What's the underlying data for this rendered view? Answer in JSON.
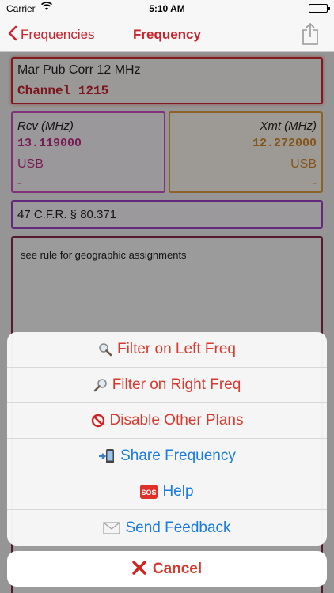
{
  "status_bar": {
    "carrier": "Carrier",
    "time": "5:10 AM"
  },
  "nav": {
    "back_label": "Frequencies",
    "title": "Frequency"
  },
  "detail": {
    "name": "Mar Pub Corr 12 MHz",
    "channel": "Channel 1215",
    "rcv": {
      "label": "Rcv (MHz)",
      "freq": "13.119000",
      "mode": "USB",
      "extra": "-"
    },
    "xmt": {
      "label": "Xmt (MHz)",
      "freq": "12.272000",
      "mode": "USB",
      "extra": "-"
    },
    "rule": "47 C.F.R. § 80.371",
    "notes": "see rule for geographic assignments"
  },
  "action_sheet": {
    "items": [
      {
        "icon": "magnifier-left-icon",
        "label": "Filter on Left Freq",
        "color": "#d83a2e"
      },
      {
        "icon": "magnifier-right-icon",
        "label": "Filter on Right Freq",
        "color": "#d83a2e"
      },
      {
        "icon": "no-entry-icon",
        "label": "Disable Other Plans",
        "color": "#d83a2e"
      },
      {
        "icon": "phone-arrow-icon",
        "label": "Share Frequency",
        "color": "#1a7ae0"
      },
      {
        "icon": "sos-icon",
        "label": "Help",
        "color": "#1a7ae0"
      },
      {
        "icon": "envelope-icon",
        "label": "Send Feedback",
        "color": "#1a7ae0"
      }
    ],
    "cancel_label": "Cancel"
  },
  "colors": {
    "accent": "#c8232c",
    "action_red": "#d83a2e",
    "action_blue": "#1a7ae0"
  }
}
